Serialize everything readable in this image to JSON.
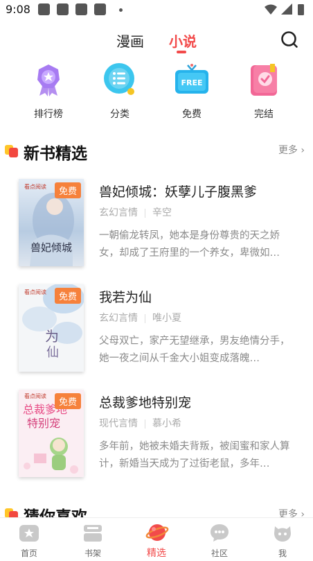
{
  "status_bar": {
    "time": "9:08"
  },
  "top_tabs": {
    "manhua": "漫画",
    "xiaoshuo": "小说"
  },
  "categories": [
    {
      "label": "排行榜",
      "icon": "ranking-medal-icon"
    },
    {
      "label": "分类",
      "icon": "category-list-icon"
    },
    {
      "label": "免费",
      "icon": "free-tv-icon"
    },
    {
      "label": "完结",
      "icon": "finished-book-icon"
    }
  ],
  "sections": {
    "new_books": {
      "title": "新书精选",
      "more": "更多"
    },
    "guess": {
      "title": "猜你喜欢",
      "more": "更多"
    }
  },
  "books": [
    {
      "title": "兽妃倾城：妖孽儿子腹黑爹",
      "genre": "玄幻言情",
      "author": "辛空",
      "desc": "一朝偷龙转凤，她本是身份尊贵的天之娇女，却成了王府里的一个养女，卑微如…",
      "badge": "免费"
    },
    {
      "title": "我若为仙",
      "genre": "玄幻言情",
      "author": "唯小夏",
      "desc": "父母双亡，家产无望继承，男友绝情分手，她一夜之间从千金大小姐变成落魄…",
      "badge": "免费"
    },
    {
      "title": "总裁爹地特别宠",
      "genre": "现代言情",
      "author": "慕小希",
      "desc": "多年前，她被未婚夫背叛，被闺蜜和家人算计，新婚当天成为了过街老鼠，多年…",
      "badge": "免费"
    }
  ],
  "bottom_nav": [
    {
      "label": "首页"
    },
    {
      "label": "书架"
    },
    {
      "label": "精选"
    },
    {
      "label": "社区"
    },
    {
      "label": "我"
    }
  ],
  "colors": {
    "accent": "#f24a4a",
    "badge": "#f6813b"
  }
}
